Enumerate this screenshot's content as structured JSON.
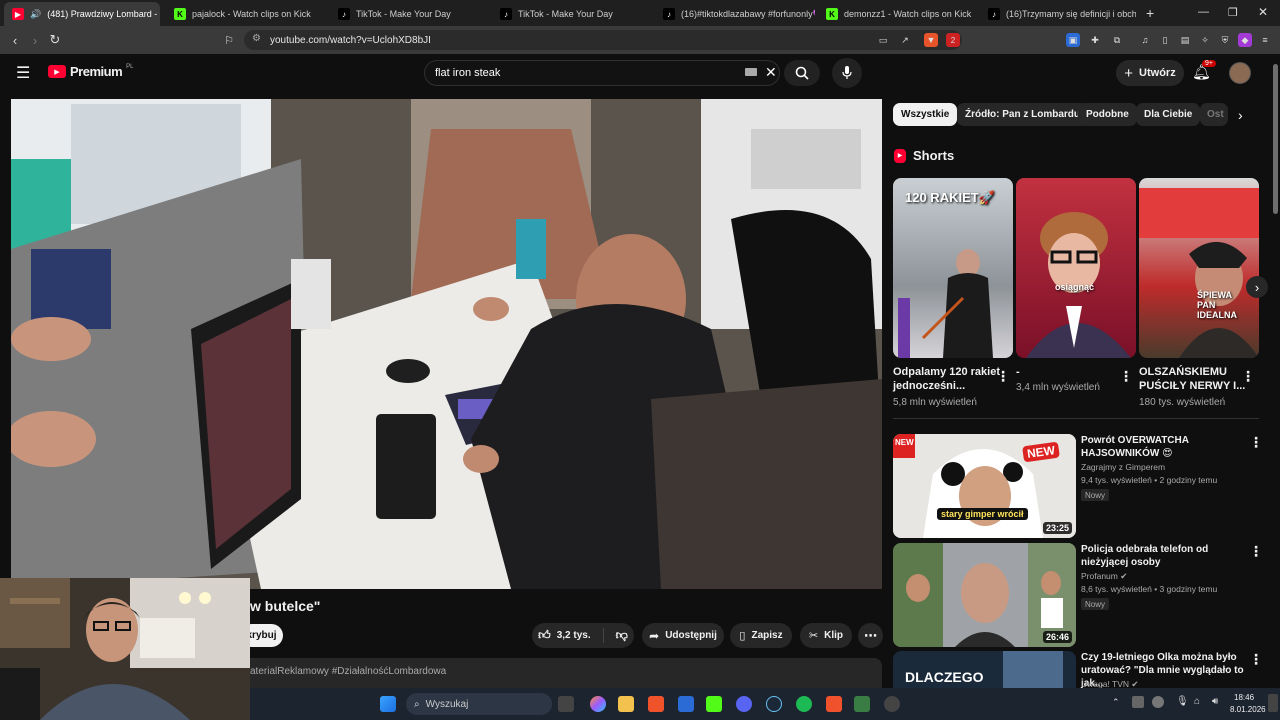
{
  "tabs": [
    {
      "label": "(481) Prawdziwy Lombard - C",
      "active": true
    },
    {
      "label": "pajalock - Watch clips on Kick"
    },
    {
      "label": "TikTok - Make Your Day"
    },
    {
      "label": "TikTok - Make Your Day"
    },
    {
      "label": "(16)#tiktokdlazabawy #forfunonly💜"
    },
    {
      "label": "demonzz1 - Watch clips on Kick"
    },
    {
      "label": "(16)Trzymamy się definicji i obchodz"
    }
  ],
  "tab_close": "×",
  "new_tab": "+",
  "address": {
    "url": "youtube.com/watch?v=UclohXD8bJI"
  },
  "extension_badge": "2",
  "youtube": {
    "logo_text": "Premium",
    "logo_region": "PL",
    "search_value": "flat iron steak",
    "create_label": "Utwórz",
    "notif_count": "9+"
  },
  "video": {
    "title_fragment": "w butelce\"",
    "subscribe_fragment": "krybuj",
    "description_fragment": "aterialReklamowy #DziałalnośćLombardowa",
    "like_count": "3,2 tys.",
    "share_label": "Udostępnij",
    "save_label": "Zapisz",
    "clip_label": "Klip"
  },
  "chips": [
    "Wszystkie",
    "Źródło: Pan z Lombardu",
    "Podobne",
    "Dla Ciebie",
    "Ost"
  ],
  "shorts": {
    "heading": "Shorts",
    "items": [
      {
        "overlay": "120 RAKIET🚀",
        "title": "Odpalamy 120 rakiet jednocześni...",
        "views": "5,8 mln wyświetleń"
      },
      {
        "overlay": "osiągnąć",
        "title": "-",
        "views": "3,4 mln wyświetleń"
      },
      {
        "overlay": "ŚPIEWA PAN IDEALNA",
        "title": "OLSZAŃSKIEMU PUŚCIŁY NERWY I...",
        "views": "180 tys. wyświetleń"
      }
    ]
  },
  "recommendations": [
    {
      "title": "Powrót OVERWATCHA HAJSOWNIKÓW 😍",
      "channel": "Zagrajmy z Gimperem",
      "meta": "9,4 tys. wyświetleń • 2 godziny temu",
      "badge": "Nowy",
      "duration": "23:25",
      "thumb_text": "stary gimper wrócił",
      "thumb_badge": "NEW"
    },
    {
      "title": "Policja odebrała telefon od nieżyjącej osoby",
      "channel": "Profanum ✔",
      "meta": "8,6 tys. wyświetleń • 3 godziny temu",
      "badge": "Nowy",
      "duration": "26:46"
    },
    {
      "title": "Czy 19-letniego Olka można było uratować? \"Dla mnie wyglądało to jak...",
      "channel": "Uwaga! TVN ✔",
      "thumb_text": "DLACZEGO"
    }
  ],
  "taskbar": {
    "search_placeholder": "Wyszukaj",
    "time": "18:46",
    "date": "8.01.2026"
  },
  "colors": {
    "accent": "#ff0033",
    "background": "#0f0f0f",
    "chip_bg": "#272727",
    "taskbar": "#1c2430"
  }
}
